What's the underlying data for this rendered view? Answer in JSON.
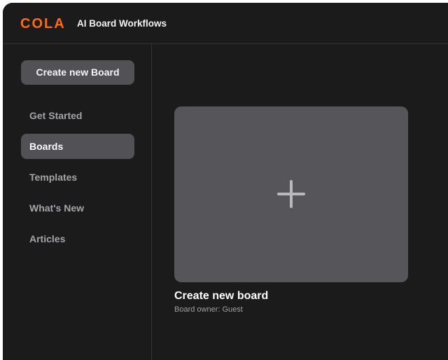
{
  "header": {
    "logo": "COLA",
    "title": "AI Board Workflows"
  },
  "sidebar": {
    "new_board_label": "Create new Board",
    "items": [
      {
        "label": "Get Started",
        "active": false
      },
      {
        "label": "Boards",
        "active": true
      },
      {
        "label": "Templates",
        "active": false
      },
      {
        "label": "What's New",
        "active": false
      },
      {
        "label": "Articles",
        "active": false
      }
    ]
  },
  "main": {
    "card": {
      "icon": "plus-icon",
      "title": "Create new board",
      "owner": "Board owner: Guest"
    }
  },
  "colors": {
    "brand": "#ff6a13",
    "background": "#1b1b1c",
    "button": "#515156",
    "card": "#55555a"
  }
}
